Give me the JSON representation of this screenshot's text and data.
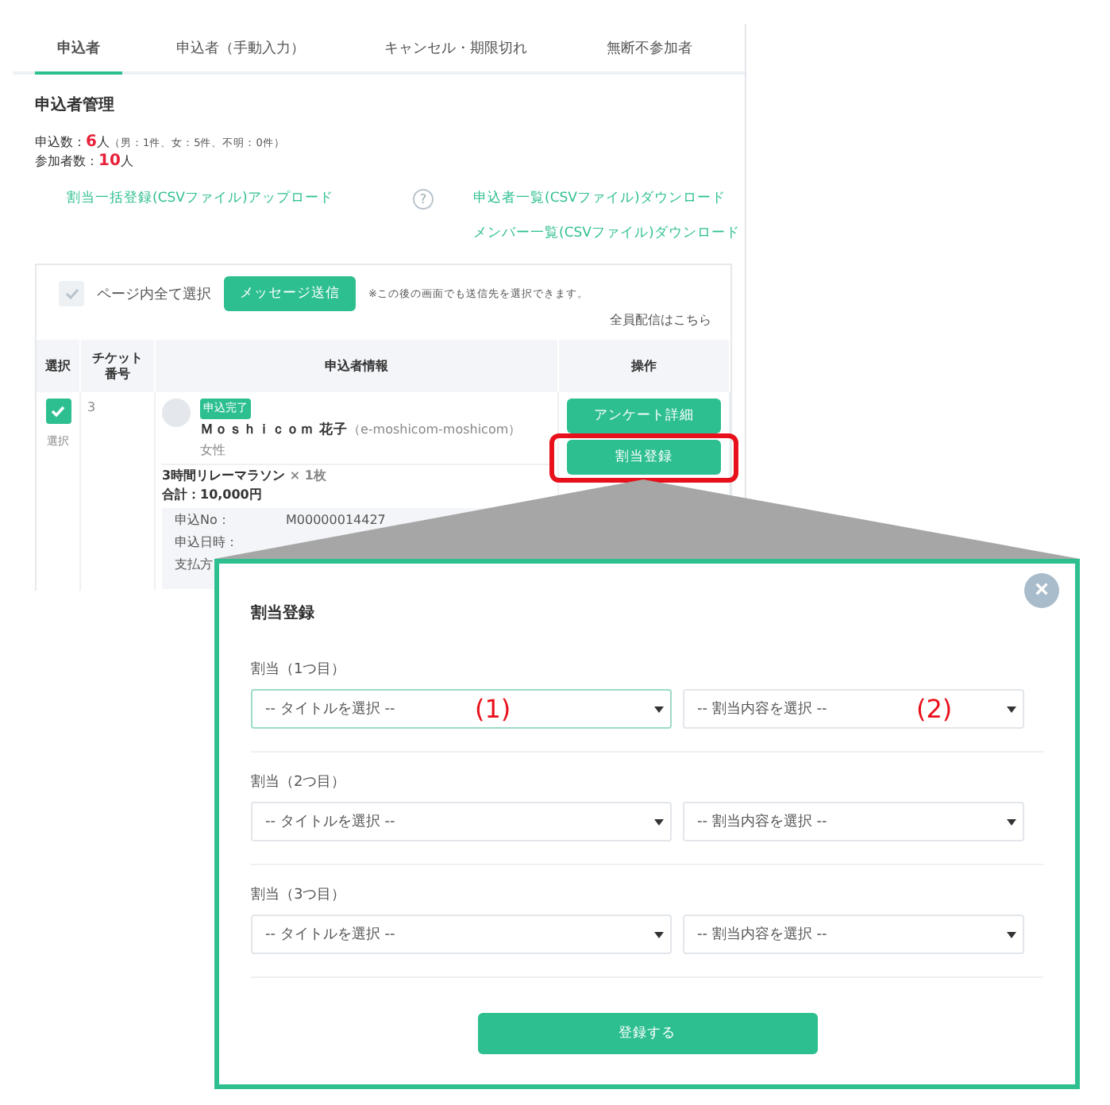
{
  "tabs": [
    {
      "label": "申込者",
      "selected": true
    },
    {
      "label": "申込者（手動入力）",
      "selected": false
    },
    {
      "label": "キャンセル・期限切れ",
      "selected": false
    },
    {
      "label": "無断不参加者",
      "selected": false
    }
  ],
  "section_title": "申込者管理",
  "stats": [
    {
      "text": "申込数：**6**人",
      "note": "（男：1件、女：5件、不明：0件）"
    },
    {
      "text": "参加者数：**10**人"
    }
  ],
  "links": {
    "upload": "割当一括登録(CSVファイル)アップロード",
    "help": "?",
    "download_applicants": "申込者一覧(CSVファイル)ダウンロード",
    "download_members": "メンバー一覧(CSVファイル)ダウンロード"
  },
  "bulk": {
    "select_all_label": "ページ内全て選択",
    "select_all_checked": false,
    "send_button": "メッセージ送信",
    "note": "※この後の画面でも送信先を選択できます。",
    "broadcast_link": "全員配信はこちら"
  },
  "table": {
    "columns": [
      "選択",
      "チケット番号",
      "申込者情報",
      "操作"
    ],
    "rows": [
      {
        "checked": true,
        "select_label": "選択",
        "ticket_no": "3",
        "status": "申込完了",
        "name": "Ｍｏｓｈｉｃｏｍ 花子",
        "user_id": "（e-moshicom-moshicom）",
        "gender": "女性",
        "ticket": "3時間リレーマラソン",
        "quantity": "× 1枚",
        "total": "合計：10,000円",
        "details": [
          {
            "label": "申込No：",
            "value": "M00000014427"
          },
          {
            "label": "申込日時："
          },
          {
            "label": "支払方"
          }
        ],
        "actions": [
          {
            "label": "アンケート詳細",
            "highlighted": false
          },
          {
            "label": "割当登録",
            "highlighted": true
          }
        ]
      }
    ]
  },
  "modal": {
    "title": "割当登録",
    "close": "×",
    "submit": "登録する",
    "groups": [
      {
        "label": "割当（1つ目）",
        "title_select": {
          "placeholder": "-- タイトルを選択 --",
          "focused": true,
          "annotation": "(1)"
        },
        "content_select": {
          "placeholder": "-- 割当内容を選択 --",
          "focused": false,
          "annotation": "(2)"
        }
      },
      {
        "label": "割当（2つ目）",
        "title_select": {
          "placeholder": "-- タイトルを選択 --",
          "focused": false
        },
        "content_select": {
          "placeholder": "-- 割当内容を選択 --",
          "focused": false
        }
      },
      {
        "label": "割当（3つ目）",
        "title_select": {
          "placeholder": "-- タイトルを選択 --",
          "focused": false
        },
        "content_select": {
          "placeholder": "-- 割当内容を選択 --",
          "focused": false
        }
      }
    ]
  }
}
